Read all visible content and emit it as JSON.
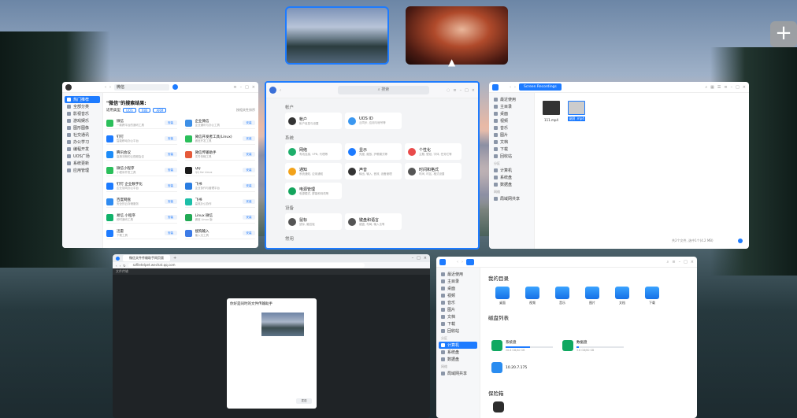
{
  "workspaces": {
    "add_icon": "+"
  },
  "store": {
    "search_text": "微信",
    "sidebar": [
      "热门推荐",
      "全部分类",
      "影视音乐",
      "游戏娱乐",
      "图形图像",
      "社交通讯",
      "办公学习",
      "编程开发",
      "UOS广场",
      "系统更新",
      "应用管理"
    ],
    "result_title": "\"微信\"的搜索结果:",
    "filter_label": "适用类型",
    "chips": [
      "UOS",
      "X86",
      "ARM"
    ],
    "sort_label": "按相关性排序",
    "apps": [
      {
        "name": "微信",
        "desc": "一款跨平台的通讯工具",
        "btn": "安装",
        "color": "#2bbf5b"
      },
      {
        "name": "企业微信",
        "desc": "企业通讯与办公工具",
        "btn": "安装",
        "color": "#3d8fe6"
      },
      {
        "name": "钉钉",
        "desc": "智能移动办公平台",
        "btn": "安装",
        "color": "#1d7bff"
      },
      {
        "name": "微信开发者工具(Linux)",
        "desc": "微信开发工具",
        "btn": "安装",
        "color": "#2bbf5b"
      },
      {
        "name": "腾讯会议",
        "desc": "高清流畅的云视频会议",
        "btn": "安装",
        "color": "#1d8cf8"
      },
      {
        "name": "微信传输助手",
        "desc": "文件传输工具",
        "btn": "安装",
        "color": "#e55a3a"
      },
      {
        "name": "微信小程序",
        "desc": "小程序开发工具",
        "btn": "安装",
        "color": "#2bbf5b"
      },
      {
        "name": "QQ",
        "desc": "QQ for Linux",
        "btn": "安装",
        "color": "#1a1a1a"
      },
      {
        "name": "钉钉 企业数字化",
        "desc": "企业协同办公平台",
        "btn": "安装",
        "color": "#1d7bff"
      },
      {
        "name": "飞书",
        "desc": "企业协作与管理平台",
        "btn": "安装",
        "color": "#2a7de1"
      },
      {
        "name": "百度网盘",
        "desc": "安全的云存储服务",
        "btn": "安装",
        "color": "#2f8bf0"
      },
      {
        "name": "飞书",
        "desc": "高效办公协作",
        "btn": "安装",
        "color": "#1dbfa8"
      },
      {
        "name": "易信 小程序",
        "desc": "即时通讯工具",
        "btn": "安装",
        "color": "#10b26a"
      },
      {
        "name": "Linux 微信",
        "desc": "微信 Linux 版",
        "btn": "安装",
        "color": "#22aa55"
      },
      {
        "name": "迅雷",
        "desc": "下载工具",
        "btn": "安装",
        "color": "#1d7bff"
      },
      {
        "name": "搜狗输入",
        "desc": "输入法工具",
        "btn": "安装",
        "color": "#3d7be6"
      }
    ]
  },
  "settings": {
    "search_placeholder": "搜索",
    "sections": [
      {
        "title": "帐户",
        "cards": [
          {
            "t": "帐户",
            "d": "帐户信息与设置",
            "c": "#333"
          },
          {
            "t": "UOS ID",
            "d": "云同步, 应用与帐号等",
            "c": "#3a97f0"
          }
        ]
      },
      {
        "title": "系统",
        "cards": [
          {
            "t": "网络",
            "d": "有线连接, VPN, 代理等",
            "c": "#1dae6a"
          },
          {
            "t": "显示",
            "d": "亮度, 缩放, 护眼模式等",
            "c": "#1d7bff"
          },
          {
            "t": "个性化",
            "d": "主题, 壁纸, 字体, 任务栏等",
            "c": "#e94b4b"
          },
          {
            "t": "通知",
            "d": "系统通知, 应用通知",
            "c": "#f2a21a"
          },
          {
            "t": "声音",
            "d": "输出, 输入, 音效, 设备管理",
            "c": "#333"
          },
          {
            "t": "时间和格式",
            "d": "时间, 时区, 格式设置",
            "c": "#555"
          },
          {
            "t": "电源管理",
            "d": "电源模式, 屏幕和待机等",
            "c": "#13a45c"
          }
        ]
      },
      {
        "title": "设备",
        "cards": [
          {
            "t": "鼠标",
            "d": "鼠标, 触控板",
            "c": "#555"
          },
          {
            "t": "键盘和语言",
            "d": "键盘, 布局, 输入法等",
            "c": "#555"
          }
        ]
      },
      {
        "title": "常用",
        "cards": []
      }
    ]
  },
  "files": {
    "tab": "Screen Recordings",
    "sidebar": [
      "最近使用",
      "主目录",
      "桌面",
      "视频",
      "音乐",
      "图片",
      "文档",
      "下载",
      "回收站",
      "分区",
      "计算机",
      "系统盘",
      "数据盘",
      "网络",
      "局域网共享"
    ],
    "items": [
      {
        "name": "111.mp4"
      },
      {
        "name": "录屏 .mp4"
      }
    ],
    "status": "共2个文件, 选中1个(4.2 MB)"
  },
  "browser": {
    "tab_title": "微信文件传输助手网页版",
    "url": "szfiletelpet.wechat.qq.com",
    "line": "文件传输",
    "modal_title": "你好是同时的文件传输助手",
    "modal_btn": "发送"
  },
  "computer": {
    "sidebar": [
      "最近使用",
      "主目录",
      "桌面",
      "视频",
      "音乐",
      "图片",
      "文档",
      "下载",
      "回收站",
      "分区",
      "计算机",
      "系统盘",
      "数据盘",
      "网络",
      "局域网共享"
    ],
    "my_dirs_title": "我的目录",
    "folders": [
      "桌面",
      "视频",
      "音乐",
      "图片",
      "文档",
      "下载"
    ],
    "disks_title": "磁盘列表",
    "disks": [
      {
        "name": "系统盘",
        "size": "20.6 GB/40 GB",
        "fill": 0.52
      },
      {
        "name": "数据盘",
        "size": "3.6 GB/80 GB",
        "fill": 0.05
      }
    ],
    "net_item": "10.20.7.175",
    "vault_title": "保险箱"
  }
}
